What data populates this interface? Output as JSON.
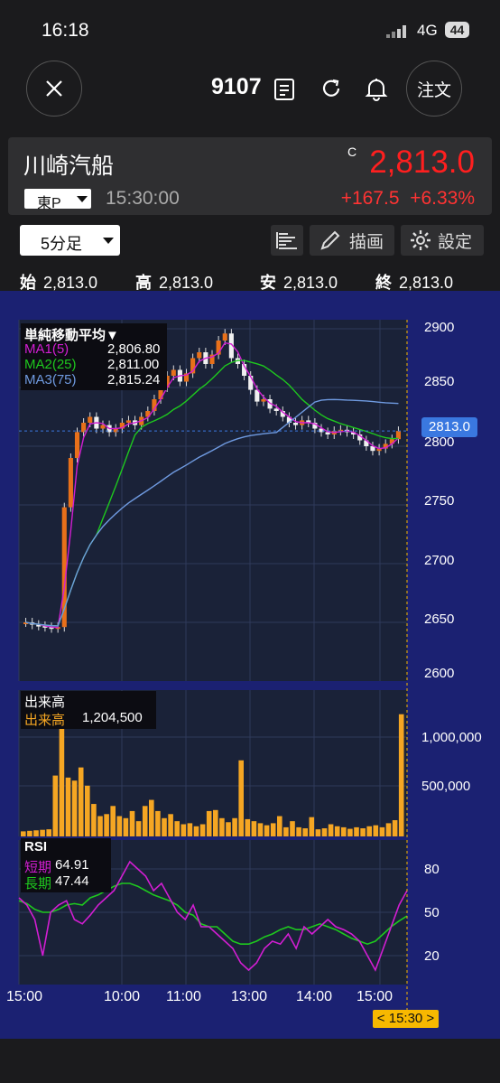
{
  "status": {
    "time": "16:18",
    "network": "4G",
    "battery": "44"
  },
  "header": {
    "code": "9107",
    "order_label": "注文"
  },
  "quote": {
    "name": "川崎汽船",
    "market": "東P",
    "time": "15:30:00",
    "close_mark": "C",
    "price": "2,813.0",
    "change": "+167.5",
    "change_pct": "+6.33%",
    "up_color": "#ff2020"
  },
  "toolbar": {
    "interval": "5分足",
    "draw_label": "描画",
    "settings_label": "設定"
  },
  "ohlc": [
    {
      "label": "始",
      "value": "2,813.0"
    },
    {
      "label": "高",
      "value": "2,813.0"
    },
    {
      "label": "安",
      "value": "2,813.0"
    },
    {
      "label": "終",
      "value": "2,813.0"
    }
  ],
  "price_panel": {
    "legend_title": "単純移動平均▼",
    "ma": [
      {
        "label": "MA1(5)",
        "value": "2,806.80",
        "color": "#d21ed2"
      },
      {
        "label": "MA2(25)",
        "value": "2,811.00",
        "color": "#1ec81e"
      },
      {
        "label": "MA3(75)",
        "value": "2,815.24",
        "color": "#6f9ae0"
      }
    ],
    "yticks": [
      "2900",
      "2850",
      "2800",
      "2750",
      "2700",
      "2650",
      "2600"
    ],
    "last_price_tag": "2813.0"
  },
  "volume_panel": {
    "title": "出来高",
    "label": "出来高",
    "value": "1,204,500",
    "yticks": [
      "1,000,000",
      "500,000"
    ],
    "bar_color": "#f5a623"
  },
  "rsi_panel": {
    "title": "RSI",
    "short_label": "短期",
    "short_value": "64.91",
    "long_label": "長期",
    "long_value": "47.44",
    "short_color": "#d21ed2",
    "long_color": "#1ec81e",
    "yticks": [
      "80",
      "50",
      "20"
    ]
  },
  "xaxis": {
    "ticks": [
      "15:00",
      "10:00",
      "11:00",
      "13:00",
      "14:00",
      "15:00"
    ],
    "cursor_label": "< 15:30 >"
  },
  "chart_data": {
    "type": "line",
    "y_range": [
      2600,
      2900
    ],
    "candles": [
      2650,
      2648,
      2647,
      2646,
      2645,
      2646,
      2748,
      2790,
      2812,
      2820,
      2825,
      2815,
      2818,
      2812,
      2815,
      2820,
      2822,
      2818,
      2825,
      2830,
      2840,
      2850,
      2860,
      2865,
      2855,
      2862,
      2875,
      2880,
      2870,
      2878,
      2890,
      2896,
      2875,
      2870,
      2860,
      2848,
      2838,
      2840,
      2832,
      2830,
      2825,
      2820,
      2818,
      2822,
      2820,
      2815,
      2812,
      2810,
      2813,
      2814,
      2812,
      2810,
      2805,
      2800,
      2796,
      2798,
      2802,
      2806,
      2813
    ],
    "volume": [
      50000,
      55000,
      60000,
      65000,
      70000,
      600000,
      1150000,
      580000,
      550000,
      680000,
      500000,
      320000,
      200000,
      220000,
      300000,
      200000,
      180000,
      250000,
      150000,
      300000,
      360000,
      250000,
      180000,
      220000,
      150000,
      120000,
      130000,
      100000,
      120000,
      250000,
      260000,
      180000,
      140000,
      180000,
      750000,
      170000,
      150000,
      130000,
      110000,
      130000,
      200000,
      90000,
      150000,
      90000,
      80000,
      190000,
      70000,
      80000,
      120000,
      100000,
      90000,
      75000,
      90000,
      80000,
      100000,
      110000,
      90000,
      130000,
      160000,
      1204500
    ],
    "rsi_short": [
      60,
      55,
      45,
      20,
      50,
      55,
      58,
      45,
      42,
      48,
      55,
      60,
      65,
      75,
      85,
      80,
      75,
      65,
      70,
      60,
      50,
      45,
      55,
      40,
      40,
      35,
      30,
      25,
      15,
      10,
      15,
      25,
      30,
      28,
      35,
      25,
      40,
      35,
      40,
      45,
      40,
      38,
      35,
      30,
      20,
      10,
      25,
      40,
      55,
      64.91
    ],
    "rsi_long": [
      58,
      56,
      52,
      50,
      50,
      52,
      55,
      56,
      55,
      60,
      62,
      65,
      68,
      70,
      70,
      68,
      65,
      62,
      60,
      58,
      55,
      50,
      48,
      42,
      40,
      40,
      35,
      30,
      28,
      28,
      30,
      33,
      35,
      38,
      40,
      38,
      38,
      40,
      42,
      40,
      38,
      35,
      32,
      30,
      28,
      30,
      35,
      40,
      44,
      47.44
    ]
  }
}
